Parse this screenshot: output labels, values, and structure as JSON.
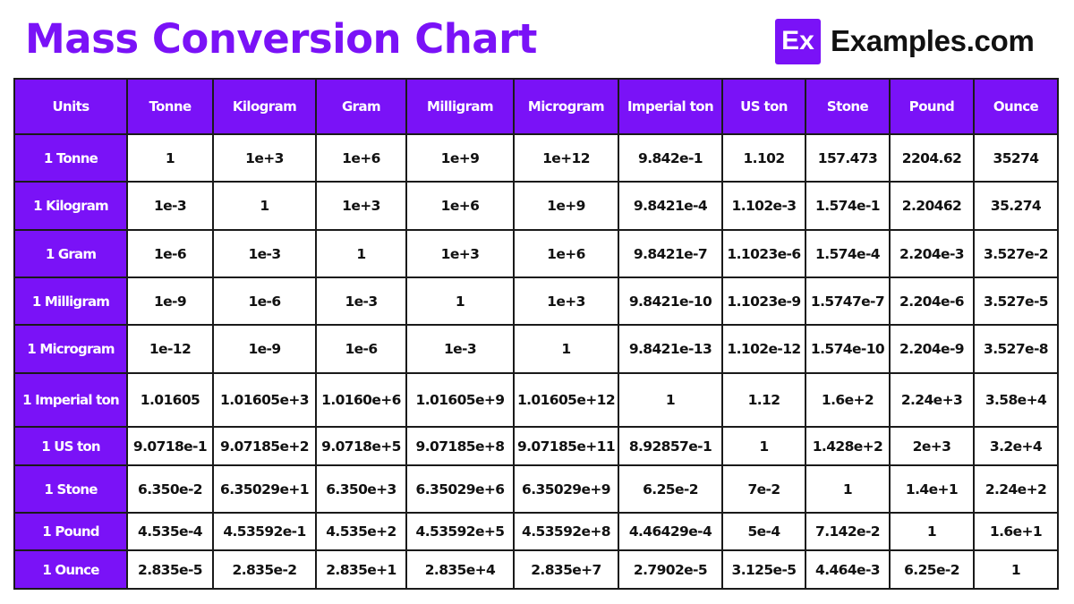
{
  "header": {
    "title": "Mass Conversion Chart",
    "brand_logo_text": "Ex",
    "brand_name": "Examples.com",
    "accent_color": "#7a12f7"
  },
  "chart_data": {
    "type": "table",
    "title": "Mass Conversion Chart",
    "corner_label": "Units",
    "columns": [
      "Tonne",
      "Kilogram",
      "Gram",
      "Milligram",
      "Microgram",
      "Imperial ton",
      "US ton",
      "Stone",
      "Pound",
      "Ounce"
    ],
    "rows": [
      {
        "label": "1 Tonne",
        "values": [
          "1",
          "1e+3",
          "1e+6",
          "1e+9",
          "1e+12",
          "9.842e-1",
          "1.102",
          "157.473",
          "2204.62",
          "35274"
        ]
      },
      {
        "label": "1 Kilogram",
        "values": [
          "1e-3",
          "1",
          "1e+3",
          "1e+6",
          "1e+9",
          "9.8421e-4",
          "1.102e-3",
          "1.574e-1",
          "2.20462",
          "35.274"
        ]
      },
      {
        "label": "1 Gram",
        "values": [
          "1e-6",
          "1e-3",
          "1",
          "1e+3",
          "1e+6",
          "9.8421e-7",
          "1.1023e-6",
          "1.574e-4",
          "2.204e-3",
          "3.527e-2"
        ]
      },
      {
        "label": "1 Milligram",
        "values": [
          "1e-9",
          "1e-6",
          "1e-3",
          "1",
          "1e+3",
          "9.8421e-10",
          "1.1023e-9",
          "1.5747e-7",
          "2.204e-6",
          "3.527e-5"
        ]
      },
      {
        "label": "1 Microgram",
        "values": [
          "1e-12",
          "1e-9",
          "1e-6",
          "1e-3",
          "1",
          "9.8421e-13",
          "1.102e-12",
          "1.574e-10",
          "2.204e-9",
          "3.527e-8"
        ]
      },
      {
        "label": "1 Imperial ton",
        "values": [
          "1.01605",
          "1.01605e+3",
          "1.0160e+6",
          "1.01605e+9",
          "1.01605e+12",
          "1",
          "1.12",
          "1.6e+2",
          "2.24e+3",
          "3.58e+4"
        ]
      },
      {
        "label": "1 US ton",
        "values": [
          "9.0718e-1",
          "9.07185e+2",
          "9.0718e+5",
          "9.07185e+8",
          "9.07185e+11",
          "8.92857e-1",
          "1",
          "1.428e+2",
          "2e+3",
          "3.2e+4"
        ]
      },
      {
        "label": "1 Stone",
        "values": [
          "6.350e-2",
          "6.35029e+1",
          "6.350e+3",
          "6.35029e+6",
          "6.35029e+9",
          "6.25e-2",
          "7e-2",
          "1",
          "1.4e+1",
          "2.24e+2"
        ]
      },
      {
        "label": "1 Pound",
        "values": [
          "4.535e-4",
          "4.53592e-1",
          "4.535e+2",
          "4.53592e+5",
          "4.53592e+8",
          "4.46429e-4",
          "5e-4",
          "7.142e-2",
          "1",
          "1.6e+1"
        ]
      },
      {
        "label": "1 Ounce",
        "values": [
          "2.835e-5",
          "2.835e-2",
          "2.835e+1",
          "2.835e+4",
          "2.835e+7",
          "2.7902e-5",
          "3.125e-5",
          "4.464e-3",
          "6.25e-2",
          "1"
        ]
      }
    ]
  }
}
